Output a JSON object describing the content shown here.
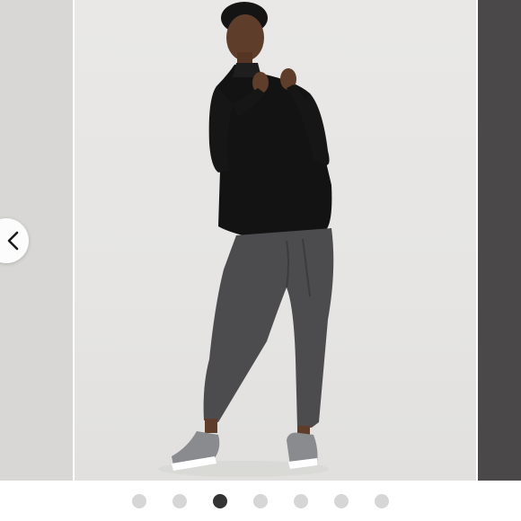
{
  "carousel": {
    "current_index": 3,
    "total": 7,
    "prev_icon": "chevron-left-icon",
    "photo_subject": "model-in-black-half-zip-and-grey-leggings",
    "colors": {
      "active_dot": "#333333",
      "inactive_dot": "#d6d6d6",
      "photo_background": "#e7e6e4",
      "next_slide": "#4a4849"
    },
    "dots": [
      {
        "active": false
      },
      {
        "active": false
      },
      {
        "active": true
      },
      {
        "active": false
      },
      {
        "active": false
      },
      {
        "active": false
      },
      {
        "active": false
      }
    ]
  }
}
